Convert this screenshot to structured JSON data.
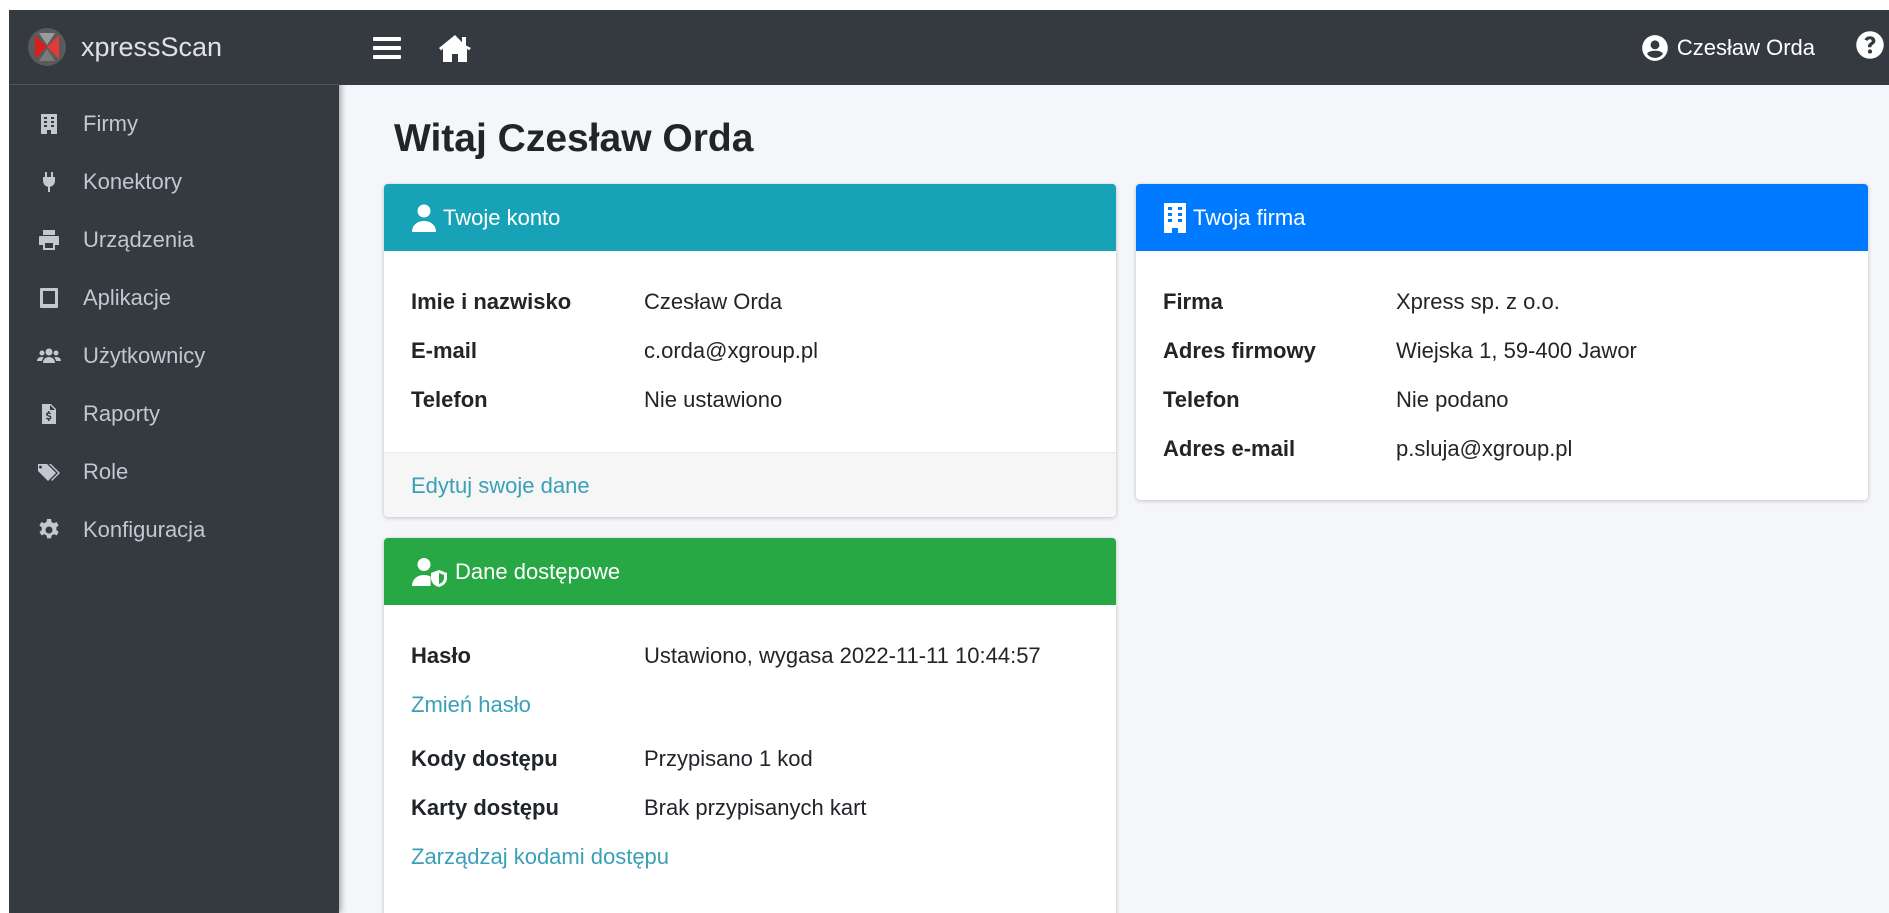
{
  "brand": {
    "name": "xpressScan",
    "logo_icon": "xpressscan-logo-icon"
  },
  "sidebar": {
    "items": [
      {
        "label": "Firmy",
        "icon": "building-icon"
      },
      {
        "label": "Konektory",
        "icon": "plug-icon"
      },
      {
        "label": "Urządzenia",
        "icon": "printer-icon"
      },
      {
        "label": "Aplikacje",
        "icon": "tablet-icon"
      },
      {
        "label": "Użytkownicy",
        "icon": "users-icon"
      },
      {
        "label": "Raporty",
        "icon": "file-invoice-icon"
      },
      {
        "label": "Role",
        "icon": "tags-icon"
      },
      {
        "label": "Konfiguracja",
        "icon": "cog-icon"
      }
    ]
  },
  "topbar": {
    "menu_icon": "hamburger-icon",
    "home_icon": "home-icon",
    "user_name": "Czesław Orda",
    "help_icon": "question-circle-icon"
  },
  "main": {
    "title": "Witaj Czesław Orda",
    "account_card": {
      "header": "Twoje konto",
      "name_label": "Imie i nazwisko",
      "name_value": "Czesław Orda",
      "email_label": "E-mail",
      "email_value": "c.orda@xgroup.pl",
      "phone_label": "Telefon",
      "phone_value": "Nie ustawiono",
      "edit_link": "Edytuj swoje dane"
    },
    "company_card": {
      "header": "Twoja firma",
      "company_label": "Firma",
      "company_value": "Xpress sp. z o.o.",
      "address_label": "Adres firmowy",
      "address_value": "Wiejska 1, 59-400 Jawor",
      "phone_label": "Telefon",
      "phone_value": "Nie podano",
      "email_label": "Adres e-mail",
      "email_value": "p.sluja@xgroup.pl"
    },
    "access_card": {
      "header": "Dane dostępowe",
      "password_label": "Hasło",
      "password_value": "Ustawiono, wygasa 2022-11-11 10:44:57",
      "change_password_link": "Zmień hasło",
      "codes_label": "Kody dostępu",
      "codes_value": "Przypisano 1 kod",
      "cards_label": "Karty dostępu",
      "cards_value": "Brak przypisanych kart",
      "manage_link": "Zarządzaj kodami dostępu"
    }
  },
  "colors": {
    "sidebar_bg": "#343a40",
    "content_bg": "#f4f6f9",
    "info": "#17a2b8",
    "primary": "#007bff",
    "success": "#28a745",
    "link": "#3aa0b7"
  }
}
